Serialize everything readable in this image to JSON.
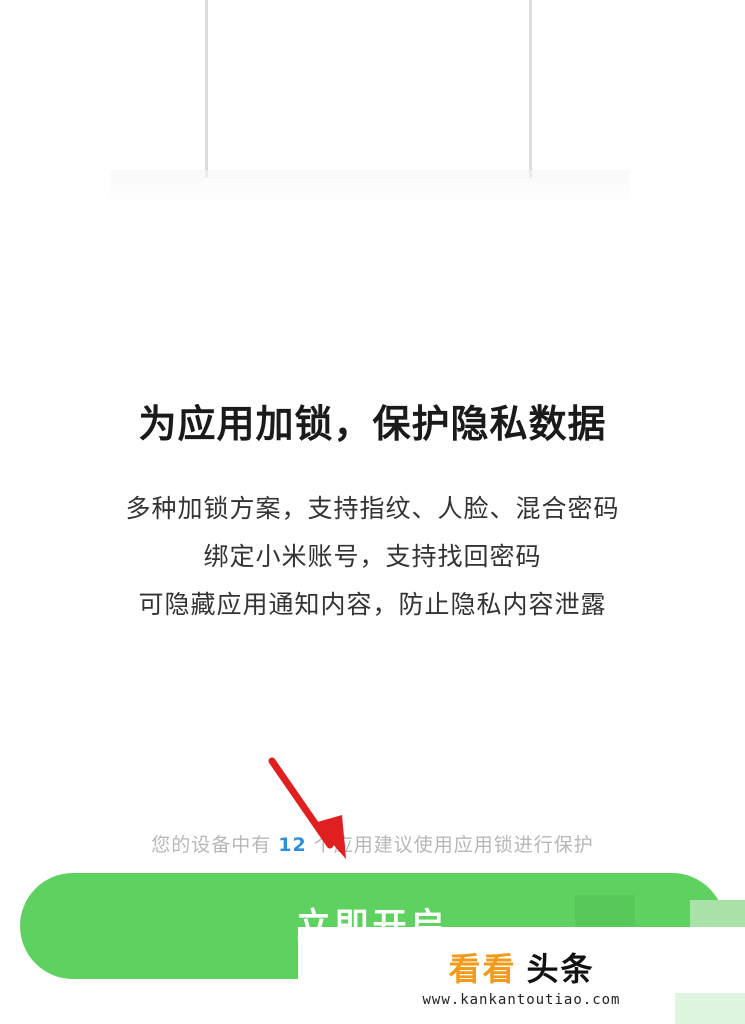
{
  "headline": "为应用加锁，保护隐私数据",
  "features": [
    "多种加锁方案，支持指纹、人脸、混合密码",
    "绑定小米账号，支持找回密码",
    "可隐藏应用通知内容，防止隐私内容泄露"
  ],
  "hint": {
    "prefix": "您的设备中有",
    "count": "12",
    "suffix": "个应用建议使用应用锁进行保护"
  },
  "enable_button": {
    "label": "立即开启"
  },
  "watermark": {
    "brand_part1": "看看",
    "brand_part2": "头条",
    "url": "www.kankantoutiao.com"
  },
  "colors": {
    "button": "#5fd160",
    "count_accent": "#2d8fe0",
    "arrow": "#e02020",
    "watermark_brand": "#f29a1a"
  }
}
